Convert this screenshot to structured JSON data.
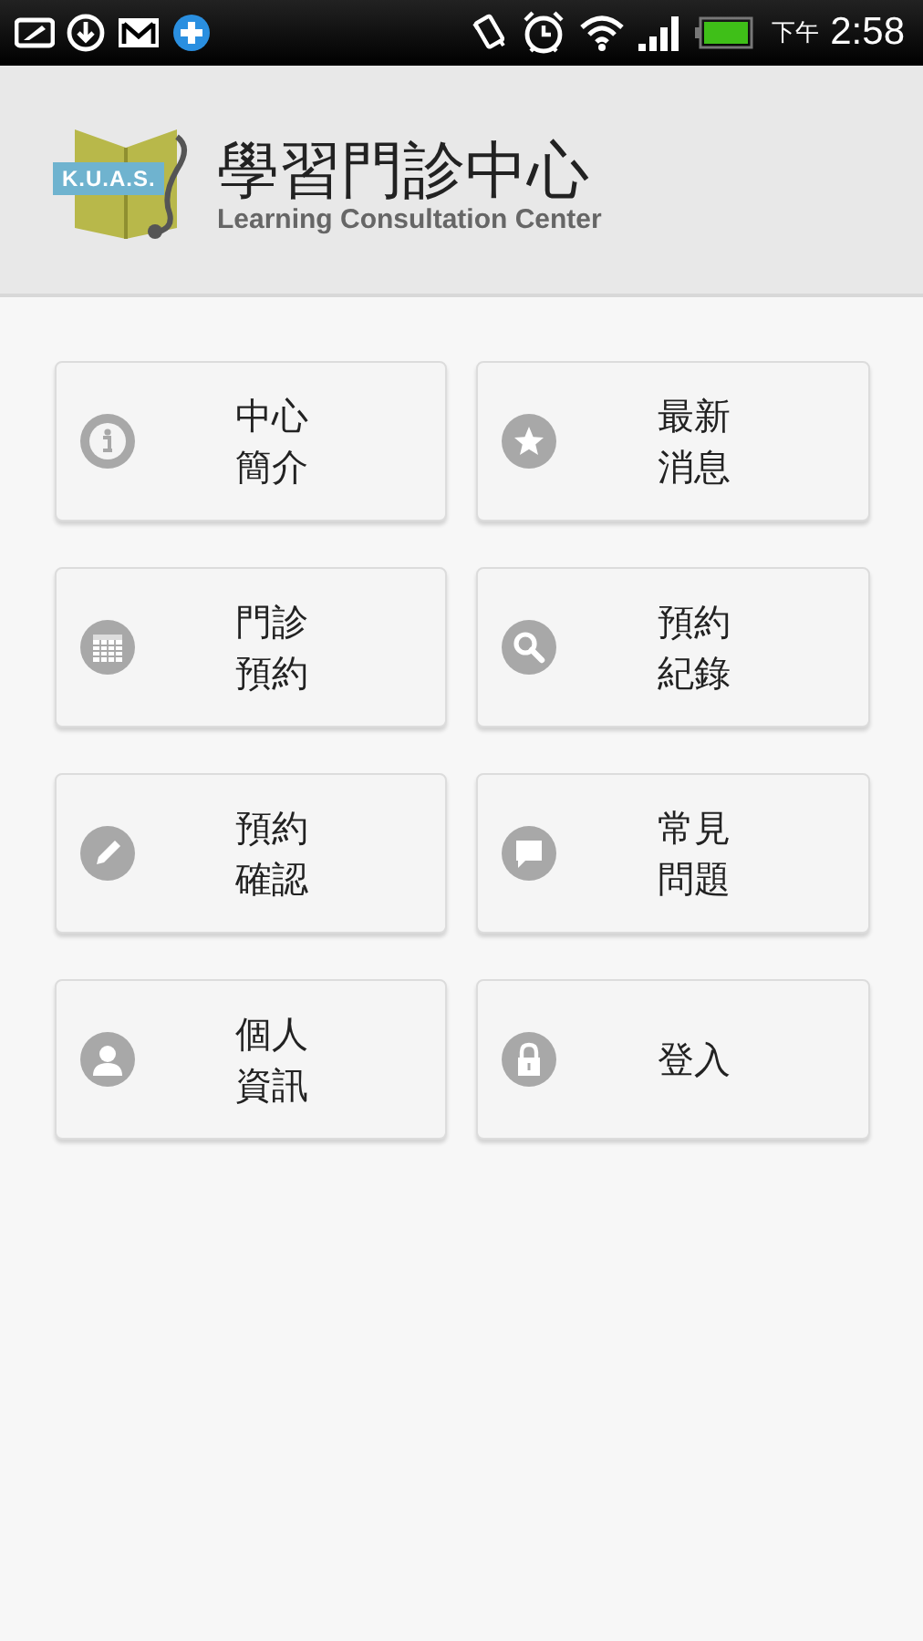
{
  "status_bar": {
    "period": "下午",
    "time": "2:58"
  },
  "header": {
    "logo_text": "K.U.A.S.",
    "title": "學習門診中心",
    "subtitle": "Learning Consultation Center"
  },
  "menu": [
    {
      "kind": "info",
      "lines": [
        "中心",
        "簡介"
      ]
    },
    {
      "kind": "star",
      "lines": [
        "最新",
        "消息"
      ]
    },
    {
      "kind": "calendar",
      "lines": [
        "門診",
        "預約"
      ]
    },
    {
      "kind": "search",
      "lines": [
        "預約",
        "紀錄"
      ]
    },
    {
      "kind": "pencil",
      "lines": [
        "預約",
        "確認"
      ]
    },
    {
      "kind": "chat",
      "lines": [
        "常見",
        "問題"
      ]
    },
    {
      "kind": "person",
      "lines": [
        "個人",
        "資訊"
      ]
    },
    {
      "kind": "lock",
      "lines": [
        "登入"
      ]
    }
  ]
}
